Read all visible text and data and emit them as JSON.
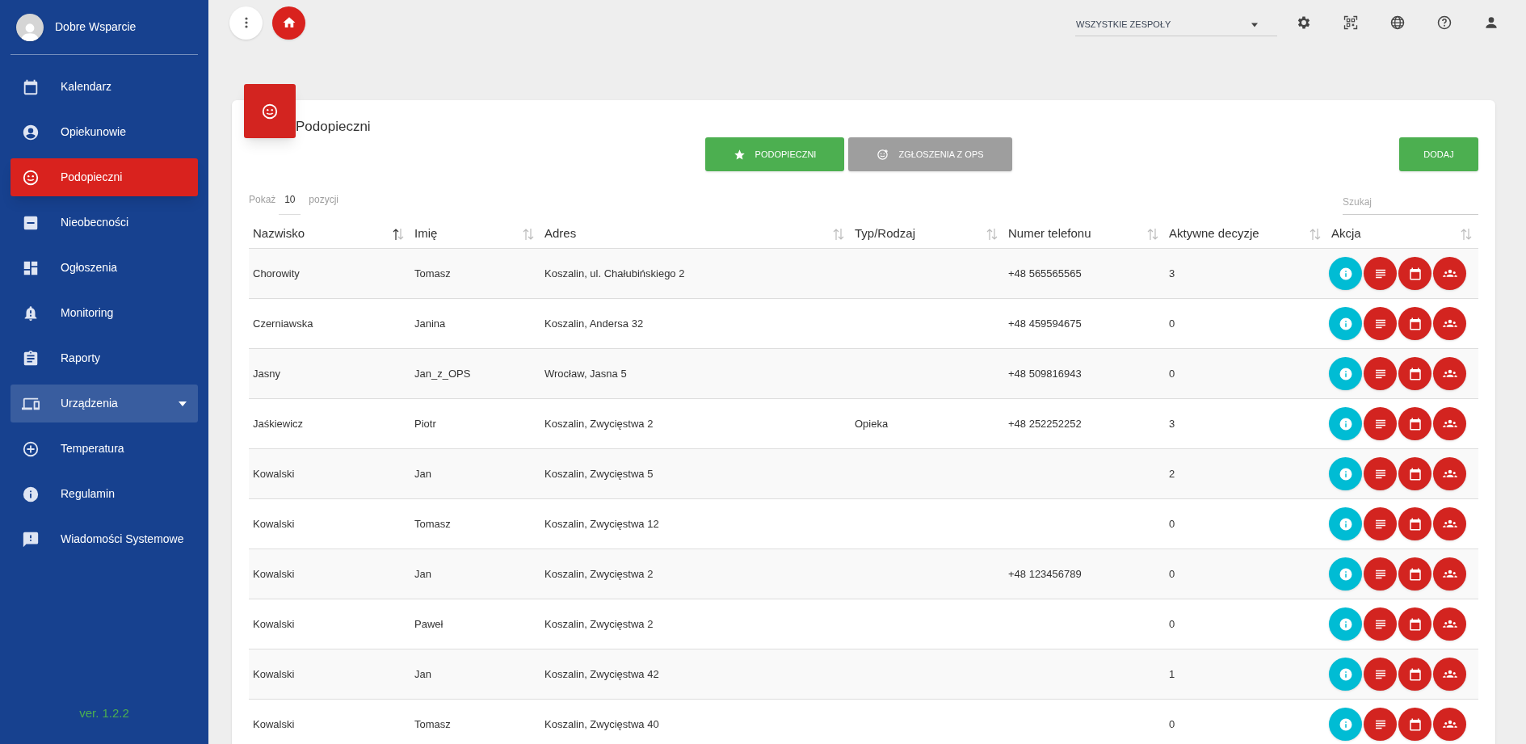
{
  "sidebar": {
    "user": "Dobre Wsparcie",
    "items": [
      {
        "label": "Kalendarz",
        "kind": "link",
        "selected": false
      },
      {
        "label": "Opiekunowie",
        "kind": "link",
        "selected": false
      },
      {
        "label": "Podopieczni",
        "kind": "link",
        "selected": true
      },
      {
        "label": "Nieobecności",
        "kind": "link",
        "selected": false
      },
      {
        "label": "Ogłoszenia",
        "kind": "link",
        "selected": false
      },
      {
        "label": "Monitoring",
        "kind": "link",
        "selected": false
      },
      {
        "label": "Raporty",
        "kind": "link",
        "selected": false
      },
      {
        "label": "Urządzenia",
        "kind": "group",
        "selected": false
      },
      {
        "label": "Temperatura",
        "kind": "link",
        "selected": false
      },
      {
        "label": "Regulamin",
        "kind": "link",
        "selected": false
      },
      {
        "label": "Wiadomości Systemowe",
        "kind": "link",
        "selected": false
      }
    ],
    "version": "ver. 1.2.2"
  },
  "topbar": {
    "team_select": "WSZYSTKIE ZESPOŁY"
  },
  "card": {
    "title": "Podopieczni",
    "tabs": [
      {
        "label": "PODOPIECZNI",
        "selected": true
      },
      {
        "label": "ZGŁOSZENIA Z OPS",
        "selected": false
      }
    ],
    "add_button": "DODAJ",
    "page_size": {
      "before": "Pokaż",
      "value": "10",
      "after": "pozycji"
    },
    "search": {
      "placeholder": "Szukaj"
    },
    "table": {
      "columns": [
        {
          "label": "Nazwisko",
          "sorted": true
        },
        {
          "label": "Imię",
          "sorted": false
        },
        {
          "label": "Adres",
          "sorted": false
        },
        {
          "label": "Typ/Rodzaj",
          "sorted": false
        },
        {
          "label": "Numer telefonu",
          "sorted": false
        },
        {
          "label": "Aktywne decyzje",
          "sorted": false
        },
        {
          "label": "Akcja",
          "sorted": false
        }
      ],
      "rows": [
        [
          "Chorowity",
          "Tomasz",
          "Koszalin, ul. Chałubińskiego 2",
          "",
          "+48 565565565",
          "3"
        ],
        [
          "Czerniawska",
          "Janina",
          "Koszalin, Andersa 32",
          "",
          "+48 459594675",
          "0"
        ],
        [
          "Jasny",
          "Jan_z_OPS",
          "Wrocław, Jasna 5",
          "",
          "+48 509816943",
          "0"
        ],
        [
          "Jaśkiewicz",
          "Piotr",
          "Koszalin, Zwycięstwa 2",
          "Opieka",
          "+48 252252252",
          "3"
        ],
        [
          "Kowalski",
          "Jan",
          "Koszalin, Zwycięstwa 5",
          "",
          "",
          "2"
        ],
        [
          "Kowalski",
          "Tomasz",
          "Koszalin, Zwycięstwa 12",
          "",
          "",
          "0"
        ],
        [
          "Kowalski",
          "Jan",
          "Koszalin, Zwycięstwa 2",
          "",
          "+48 123456789",
          "0"
        ],
        [
          "Kowalski",
          "Paweł",
          "Koszalin, Zwycięstwa 2",
          "",
          "",
          "0"
        ],
        [
          "Kowalski",
          "Jan",
          "Koszalin, Zwycięstwa 42",
          "",
          "",
          "1"
        ],
        [
          "Kowalski",
          "Tomasz",
          "Koszalin, Zwycięstwa 40",
          "",
          "",
          "0"
        ]
      ]
    }
  }
}
